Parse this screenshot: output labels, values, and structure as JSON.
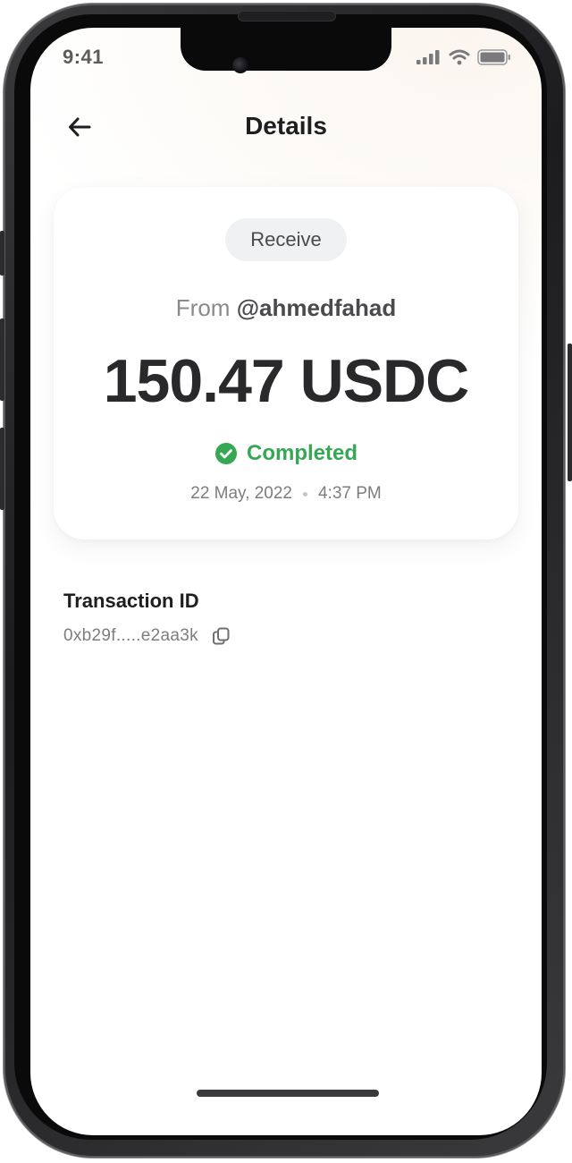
{
  "status_bar": {
    "time": "9:41",
    "icons": [
      "cellular-signal-icon",
      "wifi-icon",
      "battery-icon"
    ]
  },
  "header": {
    "title": "Details",
    "back_icon": "arrow-left-icon"
  },
  "transaction": {
    "type_label": "Receive",
    "from_prefix": "From",
    "from_handle": "@ahmedfahad",
    "amount": "150.47 USDC",
    "status": "Completed",
    "status_icon": "check-circle-icon",
    "date": "22 May, 2022",
    "time": "4:37 PM"
  },
  "transaction_id": {
    "label": "Transaction ID",
    "value": "0xb29f.....e2aa3k",
    "copy_icon": "copy-icon"
  },
  "colors": {
    "success": "#35a853",
    "text_primary": "#1e1e20",
    "text_secondary": "#7d7d80",
    "pill_bg": "#f0f1f3"
  }
}
